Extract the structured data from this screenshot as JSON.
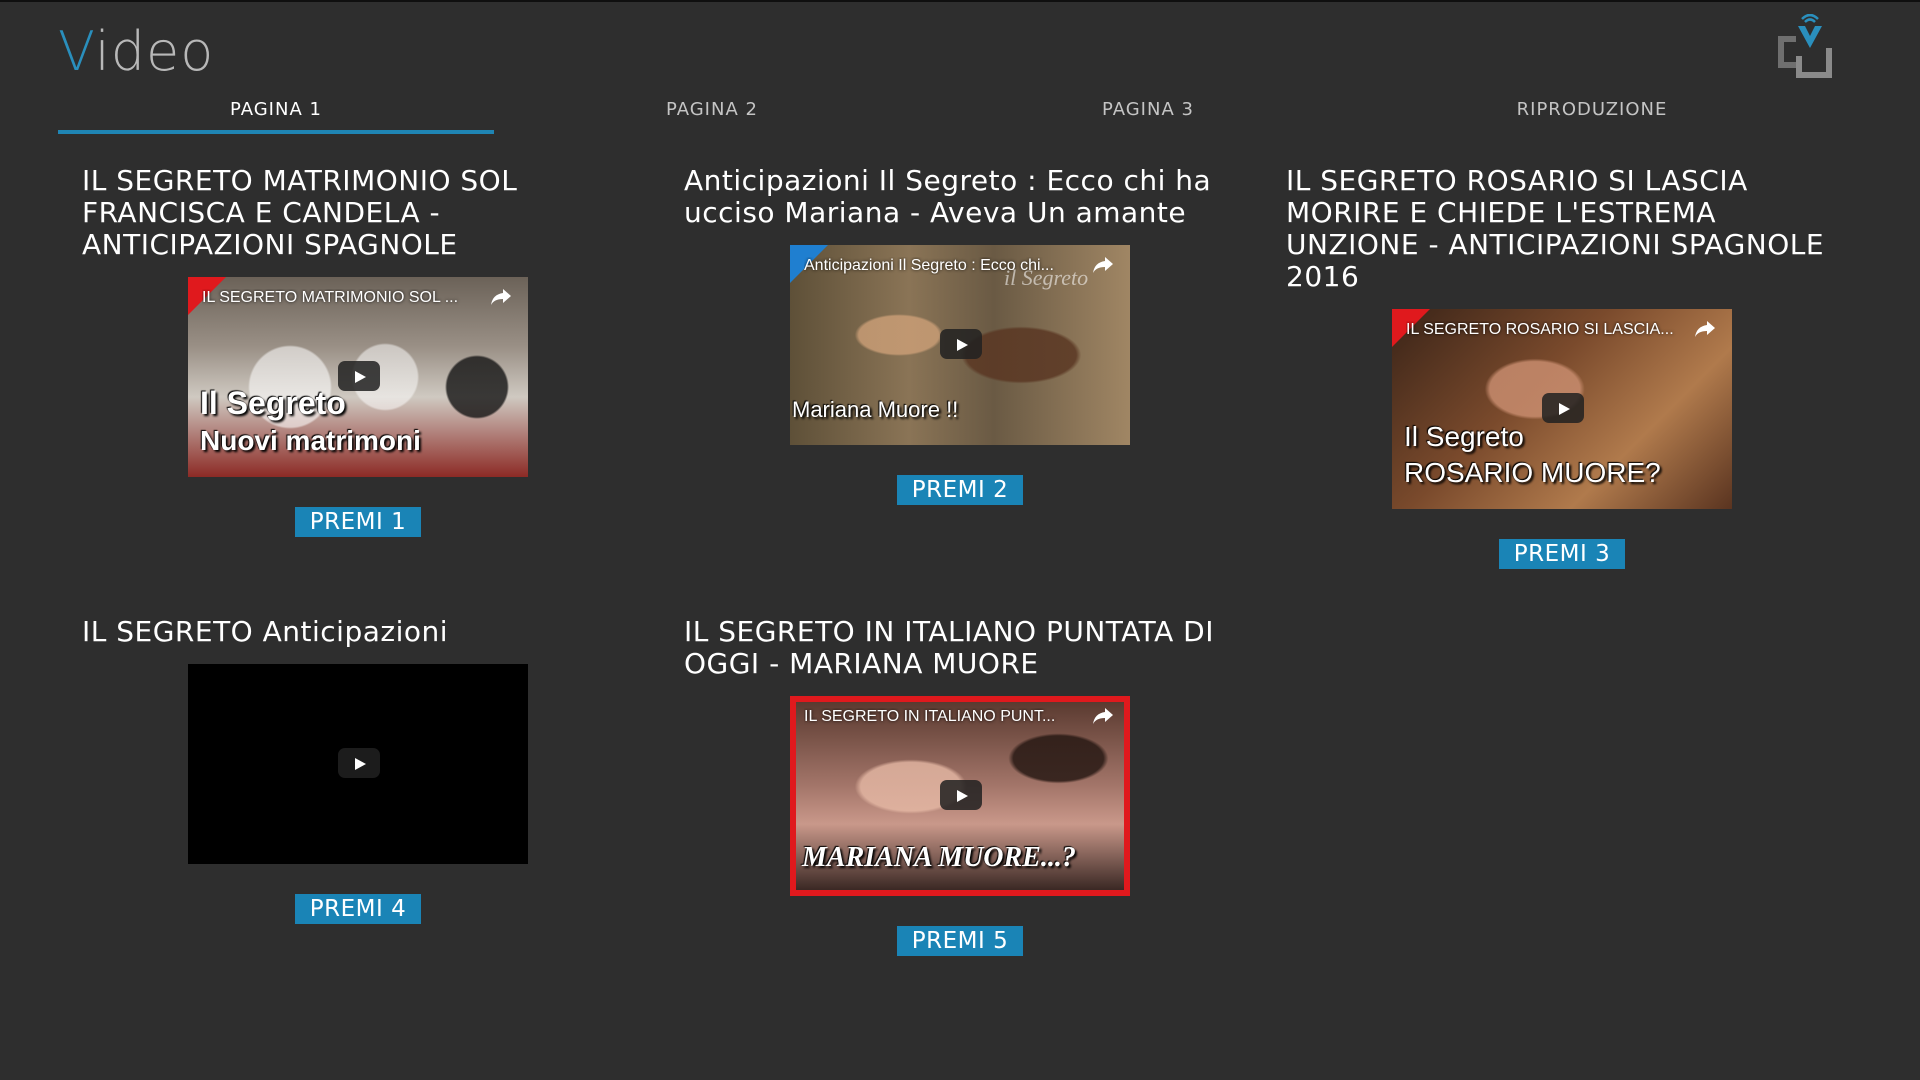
{
  "app": {
    "title_first": "V",
    "title_rest": "ideo"
  },
  "tabs": [
    {
      "label": "PAGINA 1"
    },
    {
      "label": "PAGINA 2"
    },
    {
      "label": "PAGINA 3"
    },
    {
      "label": "RIPRODUZIONE"
    }
  ],
  "videos": [
    {
      "title": "IL SEGRETO MATRIMONIO SOL FRANCISCA E CANDELA - ANTICIPAZIONI SPAGNOLE",
      "yt_title": "IL SEGRETO MATRIMONIO SOL ...",
      "overlay_1": "Il Segreto",
      "overlay_2": "Nuovi matrimoni",
      "button": "PREMI 1"
    },
    {
      "title": "Anticipazioni Il Segreto : Ecco chi ha ucciso Mariana - Aveva Un amante",
      "yt_title": "Anticipazioni Il Segreto : Ecco chi...",
      "overlay_1": "il Segreto",
      "overlay_2": "Mariana Muore !!",
      "button": "PREMI 2"
    },
    {
      "title": "IL SEGRETO ROSARIO SI LASCIA MORIRE E CHIEDE L'ESTREMA UNZIONE - ANTICIPAZIONI SPAGNOLE 2016",
      "yt_title": "IL SEGRETO ROSARIO SI LASCIA...",
      "overlay_1": "Il Segreto",
      "overlay_2": "ROSARIO MUORE?",
      "button": "PREMI 3"
    },
    {
      "title": "IL SEGRETO Anticipazioni",
      "button": "PREMI 4"
    },
    {
      "title": "IL SEGRETO IN ITALIANO PUNTATA DI OGGI - MARIANA MUORE",
      "yt_title": "IL SEGRETO IN ITALIANO PUNT...",
      "overlay_2": "MARIANA MUORE...?",
      "button": "PREMI 5"
    }
  ]
}
